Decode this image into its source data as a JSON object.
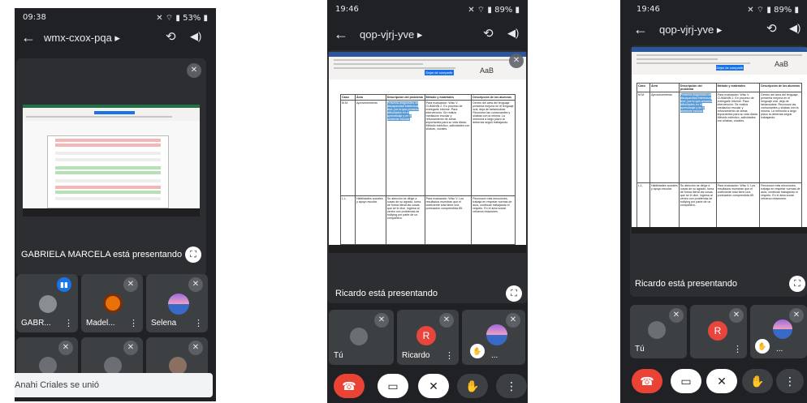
{
  "screens": [
    {
      "status_time": "09:38",
      "status_system": "53%",
      "meeting_code": "wmx-cxox-pqa",
      "presenter_text": "GABRIELA MARCELA está presentando",
      "participants": [
        {
          "name": "GABR...",
          "color": "#5f6368"
        },
        {
          "name": "Madel...",
          "color": "#e8710a"
        },
        {
          "name": "Selena",
          "color": "#9c6ade"
        }
      ],
      "toast": "Anahi Criales se unió"
    },
    {
      "status_time": "19:46",
      "status_system": "89%",
      "meeting_code": "qop-vjrj-yve",
      "presenter_text": "Ricardo está presentando",
      "share_button": "Dejar de compartir",
      "participants": [
        {
          "name": "Tú",
          "color": "#5f6368"
        },
        {
          "name": "Ricardo",
          "initial": "R",
          "color": "#e8453c"
        },
        {
          "name": "...",
          "color": "#9c6ade"
        }
      ],
      "table": {
        "headers": [
          "Caso",
          "Área",
          "Descripción del problema",
          "Método y materiales",
          "Descripción de los alumnos"
        ],
        "rows": [
          [
            "M.M.",
            "Aprovecemiento",
            "Presenta diagnóstico de discapacidad intelectual leve, por lo que presenta dificultades en el aprendizaje y en el ambiente escolar.",
            "Para evaluación: Wisc V. CUMANIN 2. En proceso de entregarle informe. Para intervención: Se realiza mediación escolar y reforzamiento de áreas importantes para su vida diaria. Método ecléctico, actividades con sílabas, vocales.",
            "Dentro del área del lenguaje, presenta mejoría en el lenguaje oral, deja de tartamudear. Reconoce las consonantes y sílabas con la misma. La memoria a largo plazo la deberías seguir trabajando."
          ],
          [
            "L.L.",
            "Habilidades sociales y apoyo escolar.",
            "Su atención se dirige a cosas de su agrado, toma de forma literal las cosas que se le dice, ingresa al centro con problemas de bullying por parte de un compañero.",
            "Para evaluación: Wisc V. Los resultados muestran que el coeficiente total tiene una puntuación comprendida 85.",
            "Reconoce más emociones, trabaja en respetar normas de aula, continuar trabajando el respeto. En el área social refuerza relaciones."
          ]
        ]
      }
    },
    {
      "status_time": "19:46",
      "status_system": "89%",
      "meeting_code": "qop-vjrj-yve",
      "presenter_text": "Ricardo está presentando",
      "share_button": "Dejar de compartir",
      "participants": [
        {
          "name": "Tú",
          "color": "#5f6368"
        },
        {
          "name": "",
          "initial": "R",
          "color": "#e8453c"
        },
        {
          "name": "...",
          "color": "#9c6ade"
        }
      ]
    }
  ],
  "icons": {
    "back": "←",
    "caret": "▸",
    "flip": "⟲",
    "speaker": "◀)",
    "mic_off": "🎙",
    "more": "⋮",
    "fullscreen": "⛶",
    "hangup": "☎",
    "camera_off": "▭",
    "hand": "✋"
  }
}
